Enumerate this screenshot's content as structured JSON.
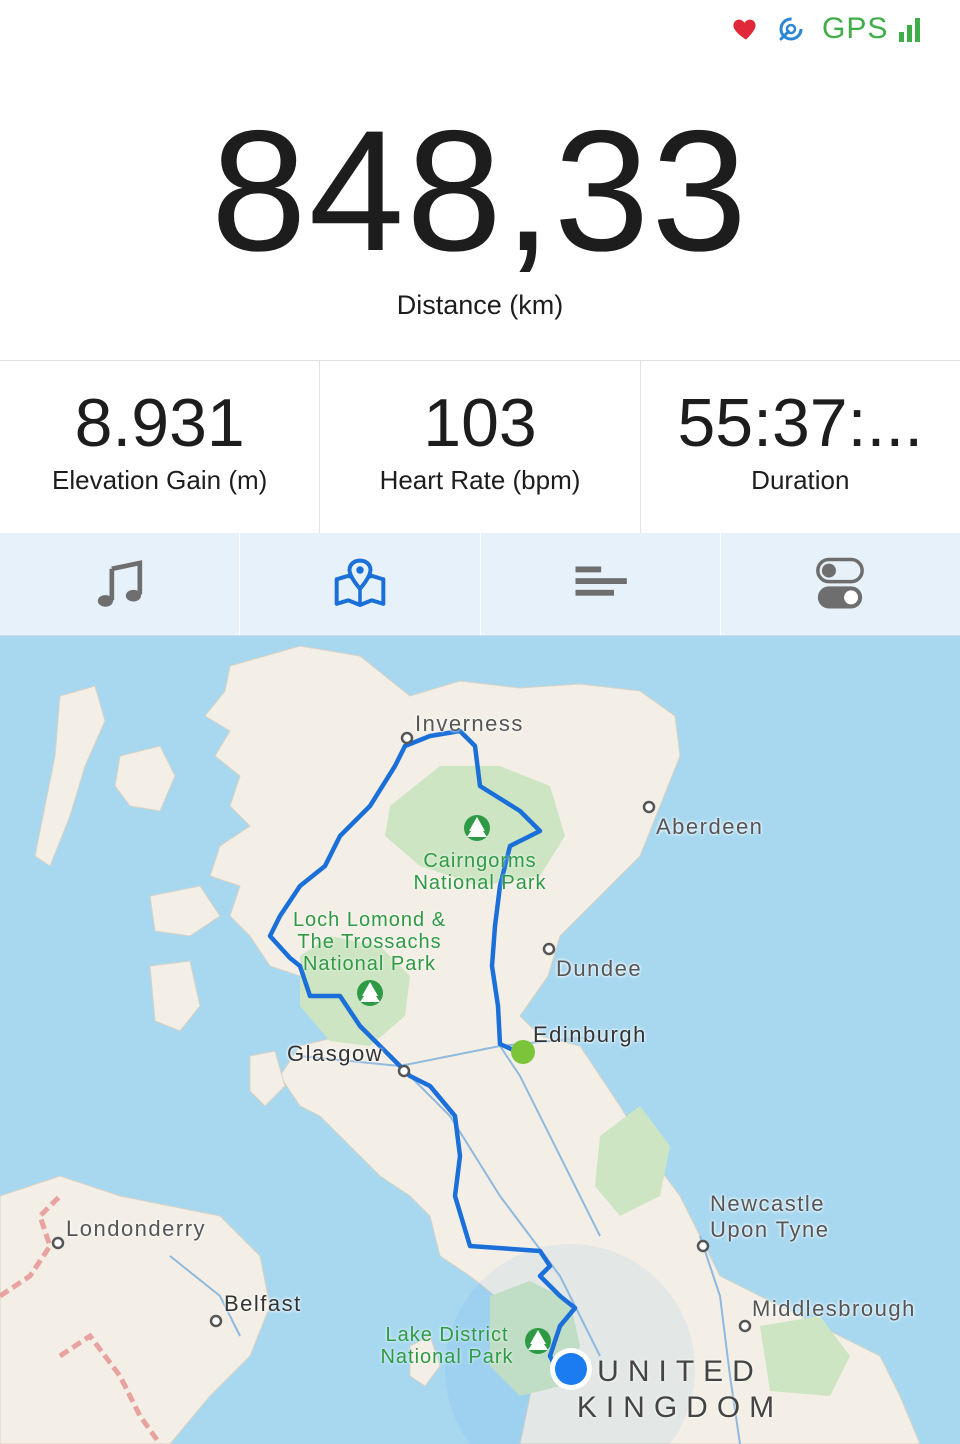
{
  "status_bar": {
    "gps_label": "GPS",
    "accent_green": "#3fae48",
    "heart_color": "#e0283a",
    "sensor_color": "#2b86d6"
  },
  "primary_metric": {
    "value": "848,33",
    "label": "Distance (km)"
  },
  "stats": [
    {
      "value": "8.931",
      "label": "Elevation Gain (m)"
    },
    {
      "value": "103",
      "label": "Heart Rate (bpm)"
    },
    {
      "value": "55:37:...",
      "label": "Duration"
    }
  ],
  "tabs": [
    {
      "icon": "music-note-icon",
      "active": false
    },
    {
      "icon": "map-icon",
      "active": true
    },
    {
      "icon": "splits-icon",
      "active": false
    },
    {
      "icon": "settings-toggle-icon",
      "active": false
    }
  ],
  "map": {
    "cities": [
      "Inverness",
      "Aberdeen",
      "Dundee",
      "Edinburgh",
      "Glasgow",
      "Londonderry",
      "Belfast",
      "Newcastle Upon Tyne",
      "Middlesbrough"
    ],
    "parks": [
      "Cairngorms National Park",
      "Loch Lomond & The Trossachs National Park",
      "Lake District National Park"
    ],
    "country": "UNITED KINGDOM",
    "route_color": "#1b6fd8",
    "start_color": "#7cc53a",
    "current_position_color": "#1a7cf0"
  }
}
